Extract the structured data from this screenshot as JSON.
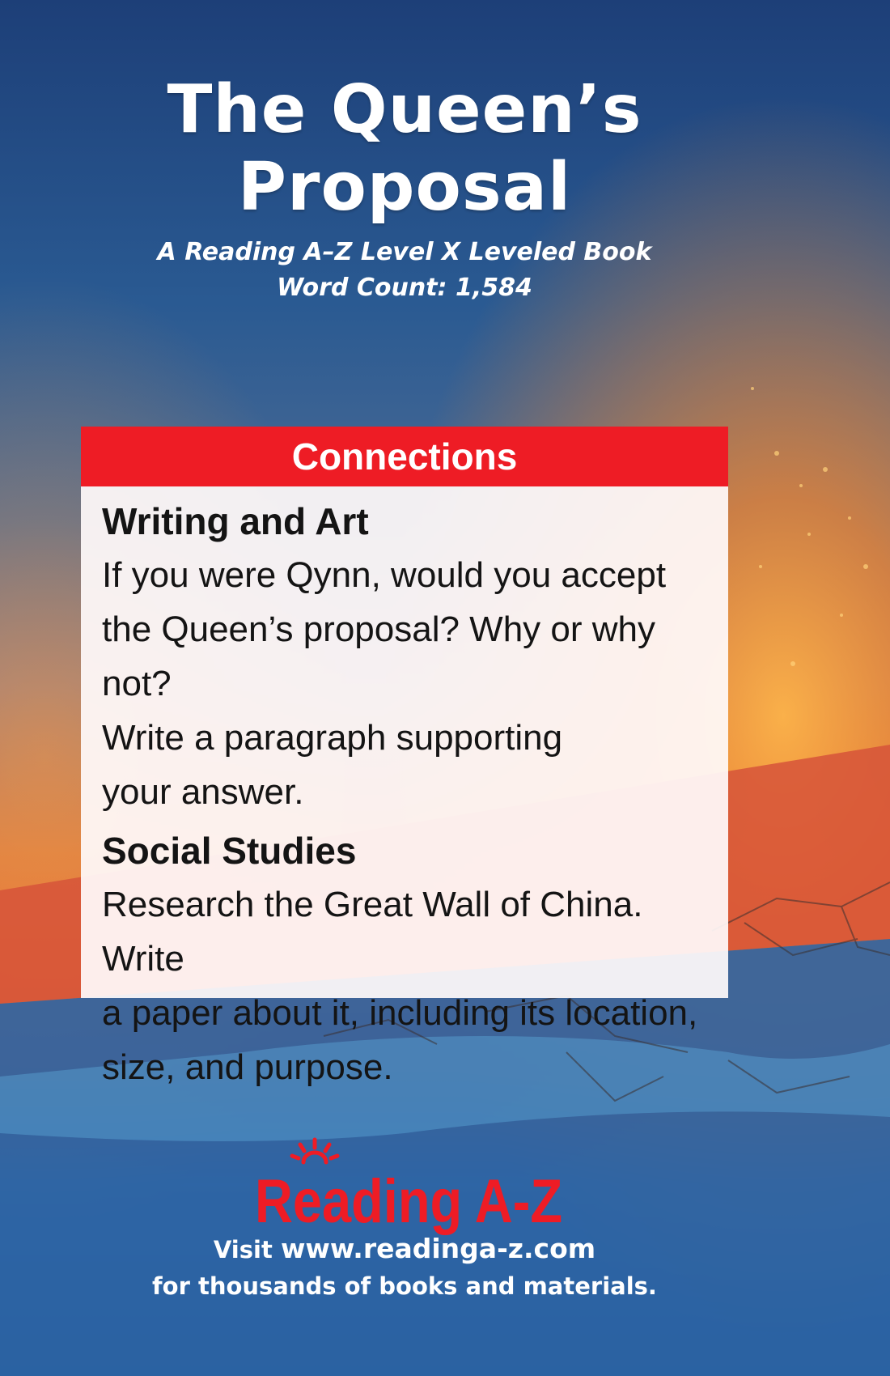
{
  "cover": {
    "title_lines": [
      "The Queen’s",
      "Proposal"
    ],
    "subtitle_line1": "A Reading A–Z Level X Leveled Book",
    "subtitle_line2": "Word Count: 1,584"
  },
  "connections": {
    "header": "Connections",
    "sections": [
      {
        "heading": "Writing and Art",
        "lines": [
          "If you were Qynn, would you accept",
          "the Queen’s proposal? Why or why not?",
          "Write a paragraph supporting",
          "your answer."
        ]
      },
      {
        "heading": "Social Studies",
        "lines": [
          "Research the Great Wall of China. Write",
          "a paper about it, including its location,",
          "size, and purpose."
        ]
      }
    ]
  },
  "brand": {
    "logo_text": "Reading A-Z",
    "logo_color": "#ee1c25"
  },
  "footer": {
    "visit": "Visit",
    "url": "www.readinga-z.com",
    "tagline": "for thousands of books and materials."
  },
  "colors": {
    "accent": "#ee1c25",
    "sky_blue": "#1e4a82",
    "sunset_orange": "#f07a28"
  }
}
